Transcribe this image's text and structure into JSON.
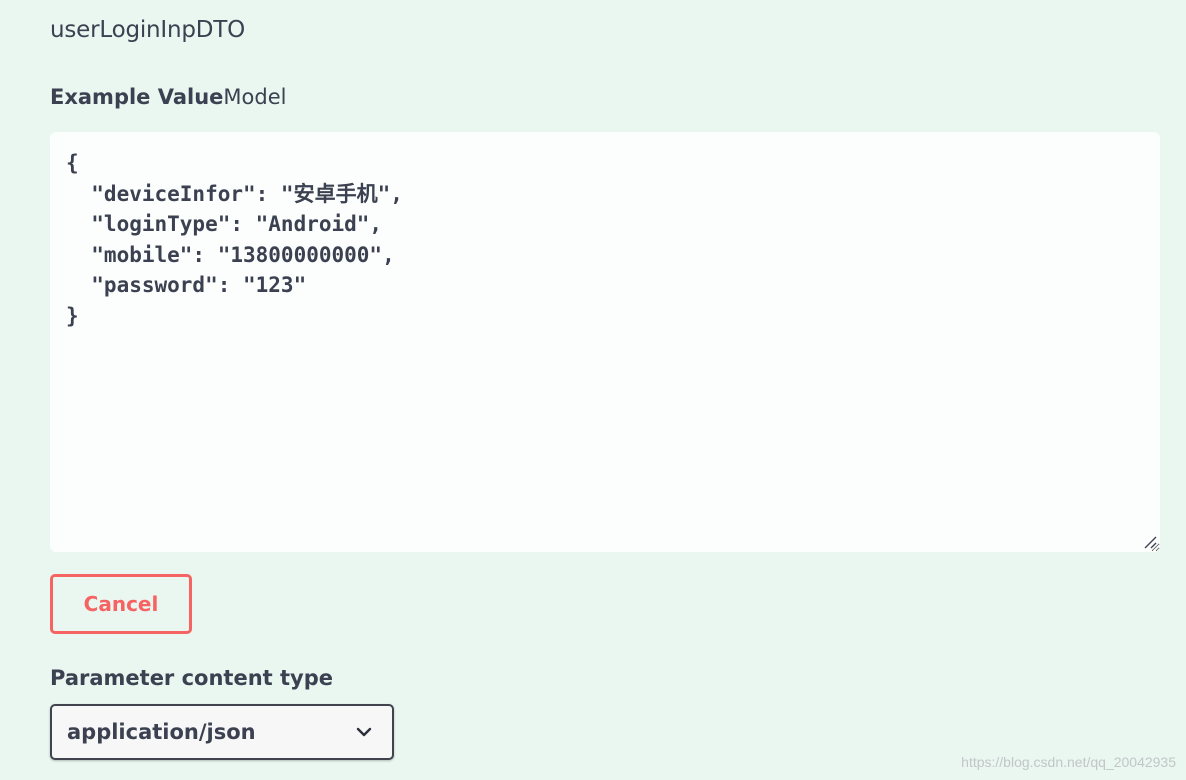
{
  "parameter": {
    "name": "userLoginInpDTO"
  },
  "tabs": {
    "example_value": "Example Value",
    "model": "Model"
  },
  "editor": {
    "value": "{\n  \"deviceInfor\": \"安卓手机\",\n  \"loginType\": \"Android\",\n  \"mobile\": \"13800000000\",\n  \"password\": \"123\"\n}"
  },
  "buttons": {
    "cancel_label": "Cancel"
  },
  "content_type": {
    "label": "Parameter content type",
    "selected": "application/json"
  },
  "icons": {
    "chevron": "chevron-down-icon",
    "resize": "resize-grip-icon"
  },
  "watermark": "https://blog.csdn.net/qq_20042935",
  "colors": {
    "background": "#eaf6f0",
    "text": "#3b4151",
    "cancel": "#f56363"
  }
}
